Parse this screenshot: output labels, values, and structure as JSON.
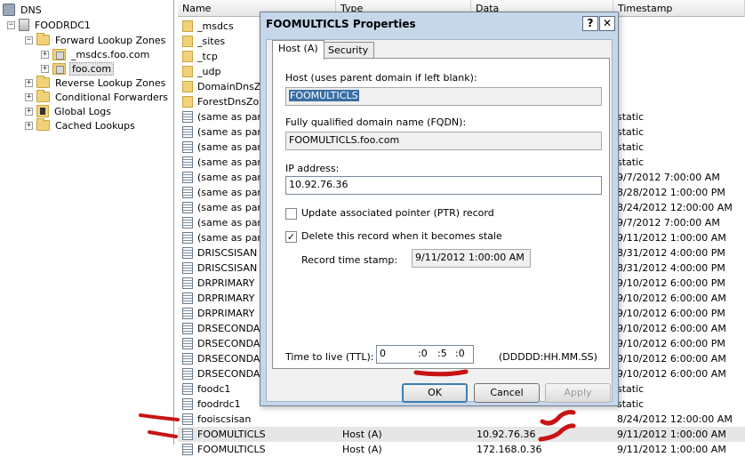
{
  "tree": {
    "root": "DNS",
    "server": "FOODRDC1",
    "forward": "Forward Lookup Zones",
    "msdcs": "_msdcs.foo.com",
    "foo": "foo.com",
    "reverse": "Reverse Lookup Zones",
    "conditional": "Conditional Forwarders",
    "global": "Global Logs",
    "cached": "Cached Lookups"
  },
  "list": {
    "headers": {
      "name": "Name",
      "type": "Type",
      "data": "Data",
      "timestamp": "Timestamp"
    },
    "rows": [
      {
        "name": "_msdcs",
        "type": "",
        "data": "",
        "ts": "",
        "icon": "folder"
      },
      {
        "name": "_sites",
        "type": "",
        "data": "",
        "ts": "",
        "icon": "folder"
      },
      {
        "name": "_tcp",
        "type": "",
        "data": "",
        "ts": "",
        "icon": "folder"
      },
      {
        "name": "_udp",
        "type": "",
        "data": "",
        "ts": "",
        "icon": "folder"
      },
      {
        "name": "DomainDnsZones",
        "type": "",
        "data": "",
        "ts": "",
        "icon": "folder"
      },
      {
        "name": "ForestDnsZones",
        "type": "",
        "data": "",
        "ts": "",
        "icon": "folder"
      },
      {
        "name": "(same as parent",
        "type": "",
        "data": "",
        "ts": "static",
        "icon": "rec"
      },
      {
        "name": "(same as parent",
        "type": "",
        "data": "",
        "ts": "static",
        "icon": "rec"
      },
      {
        "name": "(same as parent",
        "type": "",
        "data": "",
        "ts": "static",
        "icon": "rec"
      },
      {
        "name": "(same as parent",
        "type": "",
        "data": "",
        "ts": "static",
        "icon": "rec"
      },
      {
        "name": "(same as parent",
        "type": "",
        "data": "",
        "ts": "9/7/2012 7:00:00 AM",
        "icon": "rec"
      },
      {
        "name": "(same as parent",
        "type": "",
        "data": "",
        "ts": "8/28/2012 1:00:00 PM",
        "icon": "rec"
      },
      {
        "name": "(same as parent",
        "type": "",
        "data": "",
        "ts": "8/24/2012 12:00:00 AM",
        "icon": "rec"
      },
      {
        "name": "(same as parent",
        "type": "",
        "data": "",
        "ts": "9/7/2012 7:00:00 AM",
        "icon": "rec"
      },
      {
        "name": "(same as parent",
        "type": "",
        "data": "",
        "ts": "9/11/2012 1:00:00 AM",
        "icon": "rec"
      },
      {
        "name": "DRISCSISAN",
        "type": "",
        "data": "",
        "ts": "8/31/2012 4:00:00 PM",
        "icon": "rec"
      },
      {
        "name": "DRISCSISAN",
        "type": "",
        "data": "",
        "ts": "8/31/2012 4:00:00 PM",
        "icon": "rec"
      },
      {
        "name": "DRPRIMARY",
        "type": "",
        "data": "",
        "ts": "9/10/2012 6:00:00 PM",
        "icon": "rec"
      },
      {
        "name": "DRPRIMARY",
        "type": "",
        "data": "",
        "ts": "9/10/2012 6:00:00 AM",
        "icon": "rec"
      },
      {
        "name": "DRPRIMARY",
        "type": "",
        "data": "",
        "ts": "9/10/2012 6:00:00 PM",
        "icon": "rec"
      },
      {
        "name": "DRSECONDARY",
        "type": "",
        "data": "",
        "ts": "9/10/2012 6:00:00 AM",
        "icon": "rec"
      },
      {
        "name": "DRSECONDARY",
        "type": "",
        "data": "",
        "ts": "9/10/2012 6:00:00 PM",
        "icon": "rec"
      },
      {
        "name": "DRSECONDARY",
        "type": "",
        "data": "",
        "ts": "9/10/2012 6:00:00 AM",
        "icon": "rec"
      },
      {
        "name": "DRSECONDARY",
        "type": "",
        "data": "",
        "ts": "9/10/2012 6:00:00 AM",
        "icon": "rec"
      },
      {
        "name": "foodc1",
        "type": "",
        "data": "",
        "ts": "static",
        "icon": "rec"
      },
      {
        "name": "foodrdc1",
        "type": "",
        "data": "",
        "ts": "static",
        "icon": "rec"
      },
      {
        "name": "fooiscsisan",
        "type": "",
        "data": "",
        "ts": "8/24/2012 12:00:00 AM",
        "icon": "rec"
      },
      {
        "name": "FOOMULTICLS",
        "type": "Host (A)",
        "data": "10.92.76.36",
        "ts": "9/11/2012 1:00:00 AM",
        "icon": "rec"
      },
      {
        "name": "FOOMULTICLS",
        "type": "Host (A)",
        "data": "172.168.0.36",
        "ts": "9/11/2012 1:00:00 AM",
        "icon": "rec"
      }
    ]
  },
  "dialog": {
    "title": "FOOMULTICLS Properties",
    "help_btn": "?",
    "close_btn": "✕",
    "tab_host": "Host (A)",
    "tab_security": "Security",
    "host_label": "Host (uses parent domain if left blank):",
    "host_value": "FOOMULTICLS",
    "fqdn_label": "Fully qualified domain name (FQDN):",
    "fqdn_value": "FOOMULTICLS.foo.com",
    "ip_label": "IP address:",
    "ip_value": "10.92.76.36",
    "ptr_label": "Update associated pointer (PTR) record",
    "ptr_checked": false,
    "stale_label": "Delete this record when it becomes stale",
    "stale_checked": true,
    "stamp_label": "Record time stamp:",
    "stamp_value": "9/11/2012 1:00:00 AM",
    "ttl_label": "Time to live (TTL):",
    "ttl_days": "0",
    "ttl_hours": ":0",
    "ttl_minutes": ":5",
    "ttl_seconds": ":0",
    "ttl_format": "(DDDDD:HH.MM.SS)",
    "ok": "OK",
    "cancel": "Cancel",
    "apply": "Apply"
  }
}
